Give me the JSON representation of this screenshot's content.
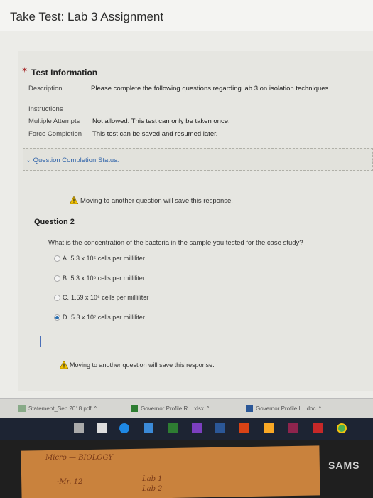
{
  "page": {
    "title": "Take Test: Lab 3 Assignment"
  },
  "test_info": {
    "heading": "Test Information",
    "description_label": "Description",
    "description_value": "Please complete the following questions regarding lab 3 on isolation techniques.",
    "instructions_label": "Instructions",
    "multiple_attempts_label": "Multiple Attempts",
    "multiple_attempts_value": "Not allowed. This test can only be taken once.",
    "force_completion_label": "Force Completion",
    "force_completion_value": "This test can be saved and resumed later."
  },
  "status": {
    "label": "Question Completion Status:"
  },
  "warning": {
    "text": "Moving to another question will save this response."
  },
  "question": {
    "title": "Question 2",
    "text": "What is the concentration of the bacteria in the sample you tested for the case study?",
    "options": [
      {
        "letter": "A.",
        "text": "5.3 x 10⁵ cells per milliliter",
        "selected": false
      },
      {
        "letter": "B.",
        "text": "5.3 x 10⁶ cells per milliliter",
        "selected": false
      },
      {
        "letter": "C.",
        "text": "1.59 x 10⁶ cells per milliliter",
        "selected": false
      },
      {
        "letter": "D.",
        "text": "5.3 x 10⁷ cells per milliliter",
        "selected": true
      }
    ]
  },
  "downloads": [
    {
      "name": "Statement_Sep 2018.pdf"
    },
    {
      "name": "Governor Profile R....xlsx"
    },
    {
      "name": "Governor Profile I....doc"
    }
  ],
  "taskbar_icons": [
    "file-explorer-icon",
    "task-view-icon",
    "edge-icon",
    "store-icon",
    "mail-icon",
    "media-icon",
    "word-icon",
    "office-icon",
    "notes-icon",
    "files-icon",
    "powerpoint-icon",
    "chrome-icon"
  ],
  "note": {
    "line1": "Micro — BIOLOGY",
    "line2": "-Mr. 12",
    "line3": "Lab 1",
    "line4": "Lab 2"
  },
  "monitor": {
    "brand": "SAMS"
  }
}
